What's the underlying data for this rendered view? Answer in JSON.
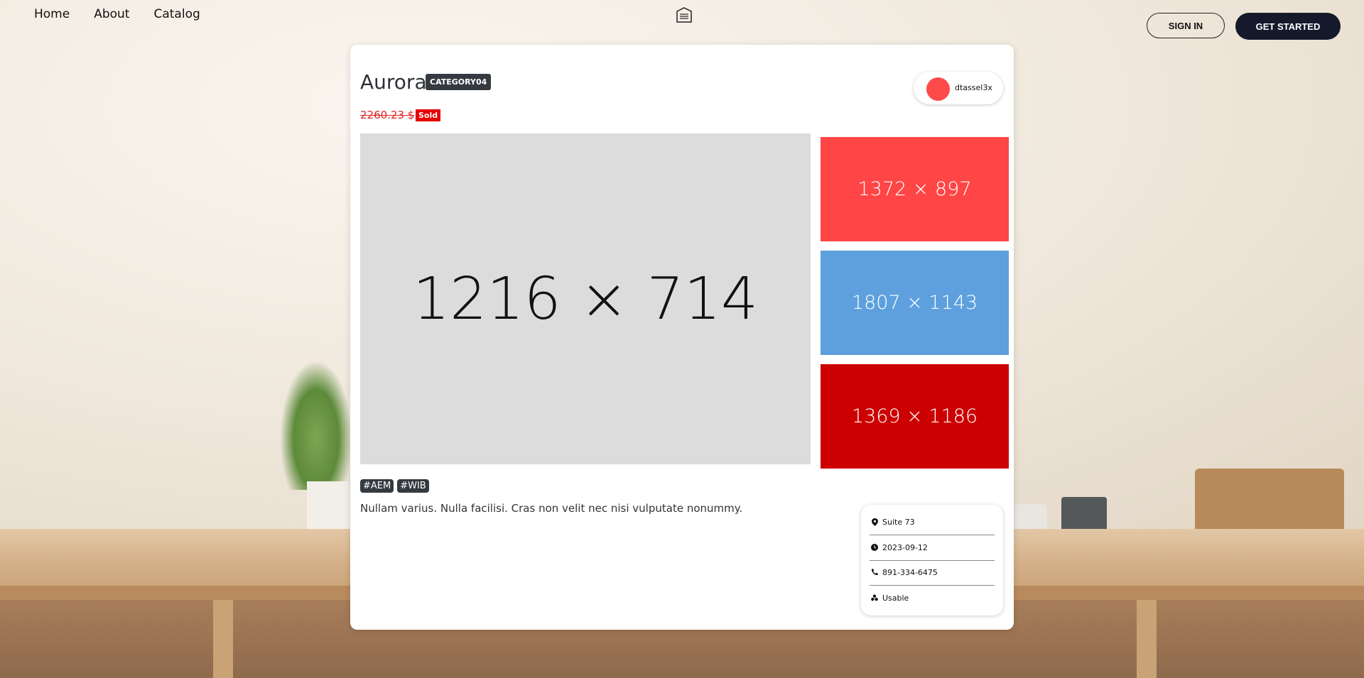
{
  "nav": {
    "links": [
      "Home",
      "About",
      "Catalog"
    ],
    "sign_in": "SIGN IN",
    "get_started": "GET STARTED"
  },
  "listing": {
    "title": "Aurora",
    "category": "CATEGORY04",
    "price": "2260.23 $",
    "status": "Sold",
    "seller": "dtassel3x",
    "images": {
      "main": "1216 × 714",
      "thumbs": [
        {
          "label": "1372 × 897",
          "color": "#ff4545"
        },
        {
          "label": "1807 × 1143",
          "color": "#5ea0dd"
        },
        {
          "label": "1369 × 1186",
          "color": "#cc0000"
        }
      ]
    },
    "tags": [
      "#AEM",
      "#WIB"
    ],
    "description": "Nullam varius. Nulla facilisi. Cras non velit nec nisi vulputate nonummy.",
    "details": [
      {
        "icon": "location-pin-icon",
        "text": "Suite 73"
      },
      {
        "icon": "clock-icon",
        "text": "2023-09-12"
      },
      {
        "icon": "phone-icon",
        "text": "891-334-6475"
      },
      {
        "icon": "condition-icon",
        "text": "Usable"
      }
    ]
  }
}
